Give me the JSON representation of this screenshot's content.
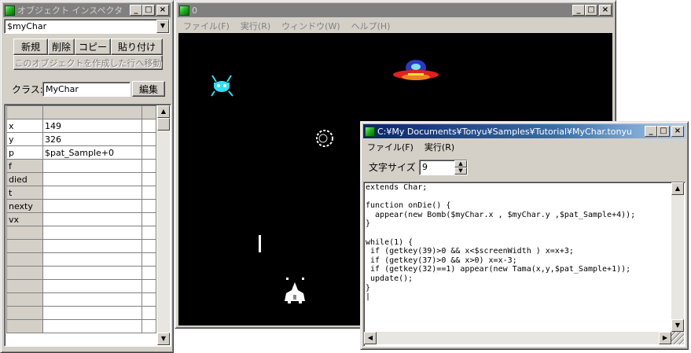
{
  "inspector": {
    "title": "オブジェクト インスペクタ",
    "object_select": "$myChar",
    "buttons": {
      "new": "新規",
      "delete": "削除",
      "copy": "コピー",
      "paste": "貼り付け"
    },
    "move_line_button": "このオブジェクトを作成した行へ移動",
    "class_label": "クラス:",
    "class_value": "MyChar",
    "edit_button": "編集",
    "properties": [
      {
        "name": "x",
        "value": "149"
      },
      {
        "name": "y",
        "value": "326"
      },
      {
        "name": "p",
        "value": "$pat_Sample+0"
      },
      {
        "name": "f",
        "value": ""
      },
      {
        "name": "died",
        "value": ""
      },
      {
        "name": "t",
        "value": ""
      },
      {
        "name": "nexty",
        "value": ""
      },
      {
        "name": "vx",
        "value": ""
      }
    ]
  },
  "game": {
    "title": "0",
    "menu": [
      "ファイル(F)",
      "実行(R)",
      "ウィンドウ(W)",
      "ヘルプ(H)"
    ]
  },
  "editor": {
    "title": "C:¥My Documents¥Tonyu¥Samples¥Tutorial¥MyChar.tonyu",
    "menu": [
      "ファイル(F)",
      "実行(R)"
    ],
    "font_size_label": "文字サイズ",
    "font_size_value": "9",
    "code": "extends Char;\n\nfunction onDie() {\n  appear(new Bomb($myChar.x , $myChar.y ,$pat_Sample+4));\n}\n\nwhile(1) {\n if (getkey(39)>0 && x<$screenWidth ) x=x+3;\n if (getkey(37)>0 && x>0) x=x-3;\n if (getkey(32)==1) appear(new Tama(x,y,$pat_Sample+1));\n update();\n}\n|"
  },
  "window_buttons": {
    "minimize": "_",
    "maximize": "□",
    "close": "×"
  },
  "colors": {
    "active_title": "#0a246a",
    "inactive_title": "#808080",
    "face": "#d4d0c8",
    "game_bg": "#000000"
  }
}
